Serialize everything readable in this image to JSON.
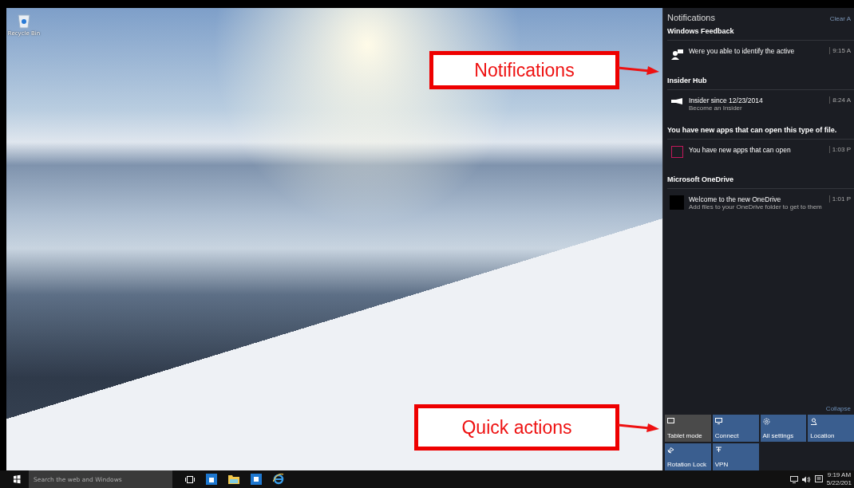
{
  "desktop": {
    "icons": [
      {
        "label": "Recycle Bin"
      }
    ]
  },
  "annotations": [
    {
      "text": "Notifications",
      "kind": "notifications"
    },
    {
      "text": "Quick actions",
      "kind": "quick"
    }
  ],
  "action_center": {
    "title": "Notifications",
    "clear_all": "Clear A",
    "groups": [
      {
        "app": "Windows Feedback",
        "items": [
          {
            "kind": "feedback",
            "title": "Were you able to identify the active",
            "time": "9:15 A"
          }
        ]
      },
      {
        "app": "Insider Hub",
        "items": [
          {
            "kind": "insider",
            "title": "Insider since 12/23/2014",
            "subtitle": "Become an Insider",
            "time": "8:24 A"
          }
        ]
      },
      {
        "app": "You have new apps that can open this type of file.",
        "items": [
          {
            "kind": "apps",
            "title": "You have new apps that can open",
            "time": "1:03 P"
          }
        ]
      },
      {
        "app": "Microsoft OneDrive",
        "items": [
          {
            "kind": "onedrive",
            "title": "Welcome to the new OneDrive",
            "subtitle": "Add files to your OneDrive folder to get to them",
            "time": "1:01 P"
          }
        ]
      }
    ],
    "collapse": "Collapse",
    "quick_actions": [
      {
        "label": "Tablet mode",
        "kind": "tablet",
        "on": false
      },
      {
        "label": "Connect",
        "kind": "connect",
        "on": true
      },
      {
        "label": "All settings",
        "kind": "settings",
        "on": true
      },
      {
        "label": "Location",
        "kind": "location",
        "on": true
      },
      {
        "label": "Rotation Lock",
        "kind": "rotation",
        "on": true
      },
      {
        "label": "VPN",
        "kind": "vpn",
        "on": true
      }
    ]
  },
  "taskbar": {
    "search_placeholder": "Search the web and Windows",
    "apps": [
      {
        "kind": "task-view"
      },
      {
        "kind": "store"
      },
      {
        "kind": "explorer"
      },
      {
        "kind": "outlook"
      },
      {
        "kind": "ie"
      }
    ],
    "clock": {
      "time": "9:19 AM",
      "date": "5/22/201"
    }
  }
}
